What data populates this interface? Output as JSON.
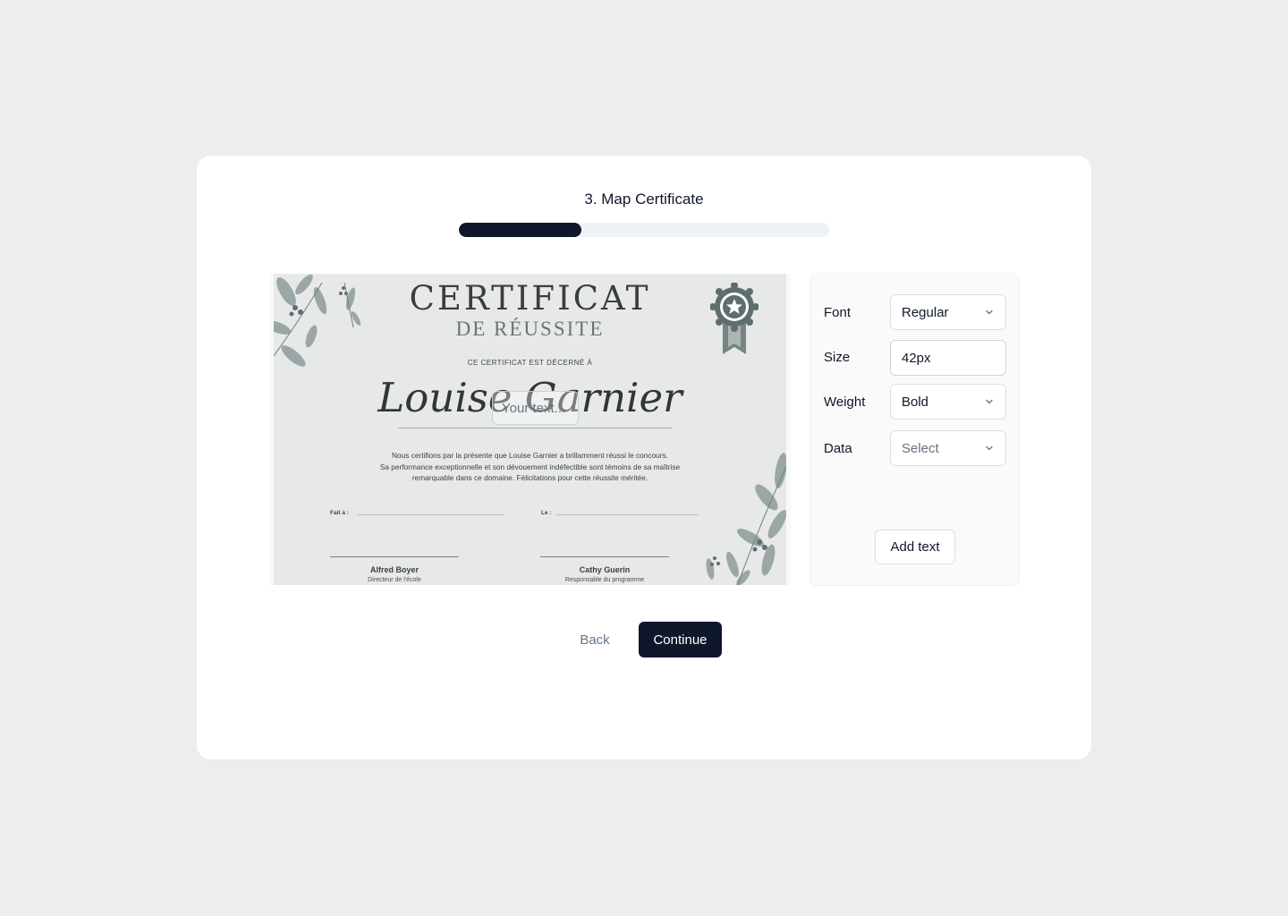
{
  "step": {
    "title": "3. Map Certificate",
    "progress": 0.33
  },
  "certificate": {
    "title": "CERTIFICAT",
    "subtitle": "DE RÉUSSITE",
    "awarded_to": "CE CERTIFICAT EST DÉCERNÉ À",
    "recipient": "Louise Garnier",
    "body_lines": [
      "Nous certifions par la présente que Louise Garnier a brillamment réussi le concours.",
      "Sa performance exceptionnelle et son dévouement indéfectible sont témoins de sa maîtrise",
      "remarquable dans ce domaine. Félicitations pour cette réussite méritée."
    ],
    "place_label": "Fait à :",
    "date_label": "Le :",
    "signatories": [
      {
        "name": "Alfred Boyer",
        "role": "Directeur de l'école"
      },
      {
        "name": "Cathy Guerin",
        "role": "Responsable du programme"
      }
    ],
    "overlay_placeholder": "Your text..."
  },
  "panel": {
    "font_label": "Font",
    "font_value": "Regular",
    "size_label": "Size",
    "size_value": "42px",
    "weight_label": "Weight",
    "weight_value": "Bold",
    "data_label": "Data",
    "data_placeholder": "Select",
    "add_text_label": "Add text"
  },
  "actions": {
    "back_label": "Back",
    "continue_label": "Continue"
  },
  "colors": {
    "primary": "#0f172a",
    "progress_track": "#eef2f6",
    "page_bg": "#ededed",
    "certificate_bg": "#e7e9e8",
    "badge": "#5e6d6e"
  }
}
